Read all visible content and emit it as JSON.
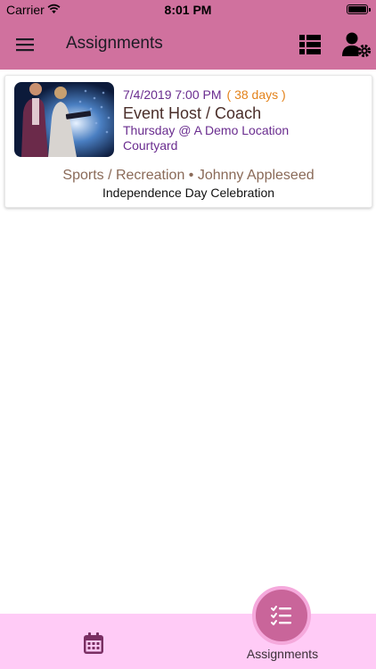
{
  "status_bar": {
    "carrier": "Carrier",
    "time": "8:01 PM"
  },
  "app_bar": {
    "title": "Assignments",
    "menu_icon": "hamburger-menu-icon",
    "list_icon": "view-list-icon",
    "user_settings_icon": "user-settings-icon"
  },
  "assignment": {
    "datetime": "7/4/2019 7:00 PM",
    "days_until": "( 38 days )",
    "role": "Event Host / Coach",
    "day_location": "Thursday @ A Demo Location",
    "area": "Courtyard",
    "category_person": "Sports / Recreation • Johnny Appleseed",
    "event_name": "Independence Day Celebration"
  },
  "bottom_nav": {
    "calendar_icon": "calendar-icon",
    "assignments_icon": "checklist-icon",
    "assignments_label": "Assignments"
  },
  "colors": {
    "app_bar": "#d0719e",
    "bottom_bar": "#ffcbf6",
    "fab": "#c9659a",
    "purple_text": "#6a2d8f",
    "orange_text": "#e3821a"
  }
}
